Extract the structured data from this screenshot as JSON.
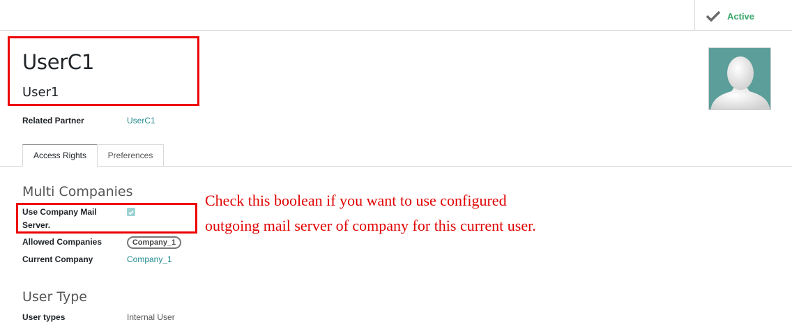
{
  "status": {
    "label": "Active",
    "color": "#3aa76d",
    "icon": "check-icon"
  },
  "user": {
    "name": "UserC1",
    "login": "User1"
  },
  "related_partner": {
    "label": "Related Partner",
    "value": "UserC1"
  },
  "tabs": [
    {
      "label": "Access Rights",
      "active": true
    },
    {
      "label": "Preferences",
      "active": false
    }
  ],
  "multi_companies": {
    "title": "Multi Companies",
    "mail_server_label_line1": "Use Company Mail",
    "mail_server_label_line2": "Server.",
    "mail_server_checked": true,
    "allowed_companies_label": "Allowed Companies",
    "allowed_companies_tag": "Company_1",
    "current_company_label": "Current Company",
    "current_company_value": "Company_1"
  },
  "user_type": {
    "title": "User Type",
    "label": "User types",
    "value": "Internal User"
  },
  "annotation": {
    "line1": "Check this boolean if you want to use configured",
    "line2": "outgoing mail server of company for this current user."
  },
  "colors": {
    "highlight_red": "#ee0000",
    "avatar_bg": "#5b9e9a",
    "link": "#1f8a8e"
  }
}
